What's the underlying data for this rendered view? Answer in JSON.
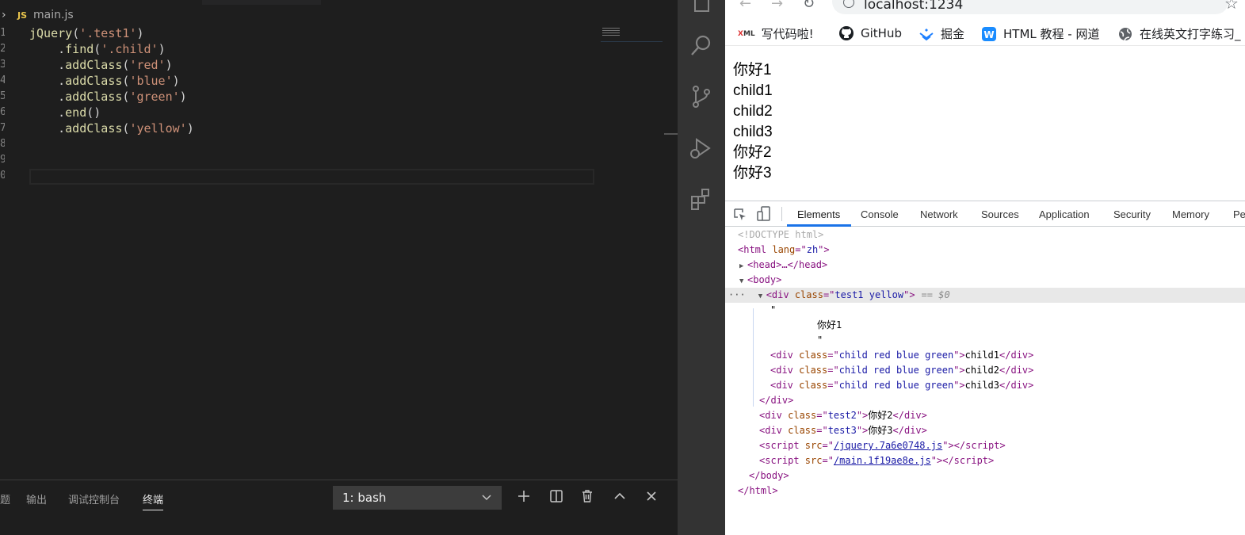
{
  "editor": {
    "filename": "main.js",
    "file_badge": "JS",
    "line_numbers": [
      "1",
      "2",
      "3",
      "4",
      "5",
      "6",
      "7",
      "8",
      "9",
      "0"
    ],
    "code": [
      [
        {
          "t": "jQuery",
          "c": "fn"
        },
        {
          "t": "(",
          "c": "p"
        },
        {
          "t": "'.test1'",
          "c": "str"
        },
        {
          "t": ")",
          "c": "p"
        }
      ],
      [
        {
          "t": "    .",
          "c": "p"
        },
        {
          "t": "find",
          "c": "fn"
        },
        {
          "t": "(",
          "c": "p"
        },
        {
          "t": "'.child'",
          "c": "str"
        },
        {
          "t": ")",
          "c": "p"
        }
      ],
      [
        {
          "t": "    .",
          "c": "p"
        },
        {
          "t": "addClass",
          "c": "fn"
        },
        {
          "t": "(",
          "c": "p"
        },
        {
          "t": "'red'",
          "c": "str"
        },
        {
          "t": ")",
          "c": "p"
        }
      ],
      [
        {
          "t": "    .",
          "c": "p"
        },
        {
          "t": "addClass",
          "c": "fn"
        },
        {
          "t": "(",
          "c": "p"
        },
        {
          "t": "'blue'",
          "c": "str"
        },
        {
          "t": ")",
          "c": "p"
        }
      ],
      [
        {
          "t": "    .",
          "c": "p"
        },
        {
          "t": "addClass",
          "c": "fn"
        },
        {
          "t": "(",
          "c": "p"
        },
        {
          "t": "'green'",
          "c": "str"
        },
        {
          "t": ")",
          "c": "p"
        }
      ],
      [
        {
          "t": "    .",
          "c": "p"
        },
        {
          "t": "end",
          "c": "fn"
        },
        {
          "t": "()",
          "c": "p"
        }
      ],
      [
        {
          "t": "    .",
          "c": "p"
        },
        {
          "t": "addClass",
          "c": "fn"
        },
        {
          "t": "(",
          "c": "p"
        },
        {
          "t": "'yellow'",
          "c": "str"
        },
        {
          "t": ")",
          "c": "p"
        }
      ]
    ]
  },
  "panel": {
    "tabs": [
      "题",
      "输出",
      "调试控制台",
      "终端"
    ],
    "active_tab": "终端",
    "terminal_select": "1: bash"
  },
  "browser": {
    "url": "localhost:1234",
    "bookmarks": [
      "写代码啦!",
      "GitHub",
      "掘金",
      "HTML 教程 - 网道",
      "在线英文打字练习_"
    ],
    "page_lines": [
      "你好1",
      "child1",
      "child2",
      "child3",
      "你好2",
      "你好3"
    ]
  },
  "devtools": {
    "tabs": [
      "Elements",
      "Console",
      "Network",
      "Sources",
      "Application",
      "Security",
      "Memory",
      "Pe"
    ],
    "active_tab": "Elements",
    "doctype": "<!DOCTYPE html>",
    "html_lang": "zh",
    "head_collapsed": "<head>…</head>",
    "selected_div_class": "test1 yellow",
    "selected_marker": "== $0",
    "text_node": "你好1",
    "children": [
      {
        "class": "child red blue green",
        "text": "child1"
      },
      {
        "class": "child red blue green",
        "text": "child2"
      },
      {
        "class": "child red blue green",
        "text": "child3"
      }
    ],
    "siblings": [
      {
        "class": "test2",
        "text": "你好2"
      },
      {
        "class": "test3",
        "text": "你好3"
      }
    ],
    "scripts": [
      "/jquery.7a6e0748.js",
      "/main.1f19ae8e.js"
    ]
  },
  "colors": {
    "editor_bg": "#1e1e1e",
    "activity_bg": "#333333",
    "string": "#ce9178",
    "function": "#dcdcaa",
    "devtools_active": "#1a73e8"
  }
}
